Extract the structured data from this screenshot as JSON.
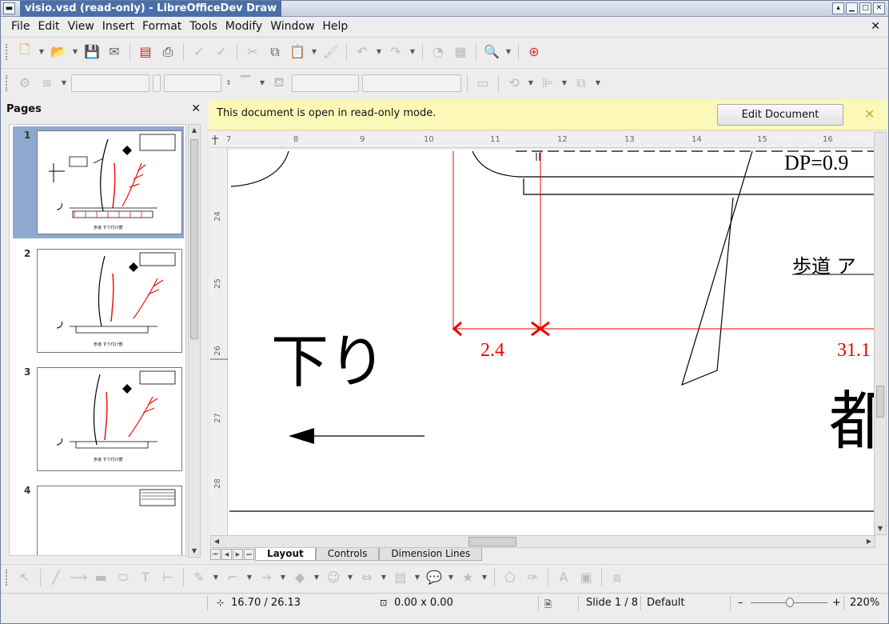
{
  "window": {
    "title": "visio.vsd (read-only) - LibreOfficeDev Draw"
  },
  "menu": [
    "File",
    "Edit",
    "View",
    "Insert",
    "Format",
    "Tools",
    "Modify",
    "Window",
    "Help"
  ],
  "pages_panel": {
    "title": "Pages",
    "pages": [
      "1",
      "2",
      "3",
      "4"
    ],
    "selected_page": "1"
  },
  "infobar": {
    "message": "This document is open in read-only mode.",
    "edit_button": "Edit Document"
  },
  "ruler": {
    "horizontal": [
      "7",
      "8",
      "9",
      "10",
      "11",
      "12",
      "13",
      "14",
      "15",
      "16"
    ],
    "vertical": [
      "24",
      "25",
      "26",
      "27",
      "28"
    ]
  },
  "drawing": {
    "dp_label": "DP=0.9",
    "sidewalk_label": "歩道 ア",
    "dim_left": "2.4",
    "dim_right": "31.1",
    "down_label": "下り",
    "big_char": "都"
  },
  "tabs": [
    "Layout",
    "Controls",
    "Dimension Lines"
  ],
  "status": {
    "position": "16.70 / 26.13",
    "size": "0.00 x 0.00",
    "slide": "Slide 1 / 8",
    "layout": "Default",
    "zoom": "220%",
    "zoom_minus": "–",
    "zoom_plus": "+"
  }
}
